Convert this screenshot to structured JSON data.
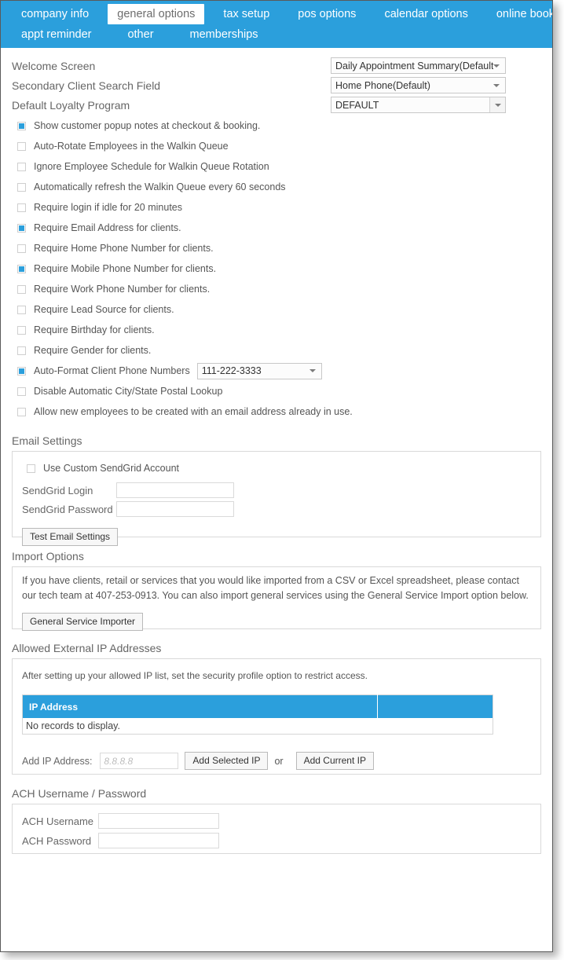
{
  "theme": {
    "accent": "#2b9fdc",
    "panel_border": "#d9d9d9",
    "label_color": "#666666"
  },
  "tabs": {
    "row1": [
      {
        "label": "company info",
        "active": false
      },
      {
        "label": "general options",
        "active": true
      },
      {
        "label": "tax setup",
        "active": false
      },
      {
        "label": "pos options",
        "active": false
      },
      {
        "label": "calendar options",
        "active": false
      },
      {
        "label": "online booking",
        "active": false
      }
    ],
    "row2": [
      {
        "label": "appt reminder",
        "active": false
      },
      {
        "label": "other",
        "active": false
      },
      {
        "label": "memberships",
        "active": false
      }
    ]
  },
  "top_settings": [
    {
      "label": "Welcome Screen",
      "value": "Daily Appointment Summary(Default)",
      "style": "plain"
    },
    {
      "label": "Secondary Client Search Field",
      "value": "Home Phone(Default)",
      "style": "plain"
    },
    {
      "label": "Default Loyalty Program",
      "value": "DEFAULT",
      "style": "boxed"
    }
  ],
  "checkboxes": [
    {
      "label": "Show customer popup notes at checkout & booking.",
      "checked": true
    },
    {
      "label": "Auto-Rotate Employees in the Walkin Queue",
      "checked": false
    },
    {
      "label": "Ignore Employee Schedule for Walkin Queue Rotation",
      "checked": false
    },
    {
      "label": "Automatically refresh the Walkin Queue every 60 seconds",
      "checked": false
    },
    {
      "label": "Require login if idle for 20 minutes",
      "checked": false
    },
    {
      "label": "Require Email Address for clients.",
      "checked": true
    },
    {
      "label": "Require Home Phone Number for clients.",
      "checked": false
    },
    {
      "label": "Require Mobile Phone Number for clients.",
      "checked": true
    },
    {
      "label": "Require Work Phone Number for clients.",
      "checked": false
    },
    {
      "label": "Require Lead Source for clients.",
      "checked": false
    },
    {
      "label": "Require Birthday for clients.",
      "checked": false
    },
    {
      "label": "Require Gender for clients.",
      "checked": false
    }
  ],
  "phone_format": {
    "label": "Auto-Format Client Phone Numbers",
    "checked": true,
    "value": "111-222-3333"
  },
  "checkboxes_after": [
    {
      "label": "Disable Automatic City/State Postal Lookup",
      "checked": false
    },
    {
      "label": "Allow new employees to be created with an email address already in use.",
      "checked": false
    }
  ],
  "email_settings": {
    "title": "Email Settings",
    "use_custom_label": "Use Custom SendGrid Account",
    "use_custom_checked": false,
    "login_label": "SendGrid Login",
    "login_value": "",
    "password_label": "SendGrid Password",
    "password_value": "",
    "test_button": "Test Email Settings"
  },
  "import_options": {
    "title": "Import Options",
    "help": "If you have clients, retail or services that you would like imported from a CSV or Excel spreadsheet, please contact our tech team at 407-253-0913. You can also import general services using the General Service Import option below.",
    "importer_button": "General Service Importer"
  },
  "ip_section": {
    "title": "Allowed External IP Addresses",
    "help": "After setting up your allowed IP list, set the security profile option to restrict access.",
    "columns": [
      "IP Address",
      ""
    ],
    "empty_message": "No records to display.",
    "add_label": "Add IP Address:",
    "add_placeholder": "8.8.8.8",
    "add_value": "",
    "add_selected_button": "Add Selected IP",
    "or_word": "or",
    "add_current_button": "Add Current IP"
  },
  "ach_section": {
    "title": "ACH Username / Password",
    "username_label": "ACH Username",
    "username_value": "",
    "password_label": "ACH Password",
    "password_value": ""
  }
}
